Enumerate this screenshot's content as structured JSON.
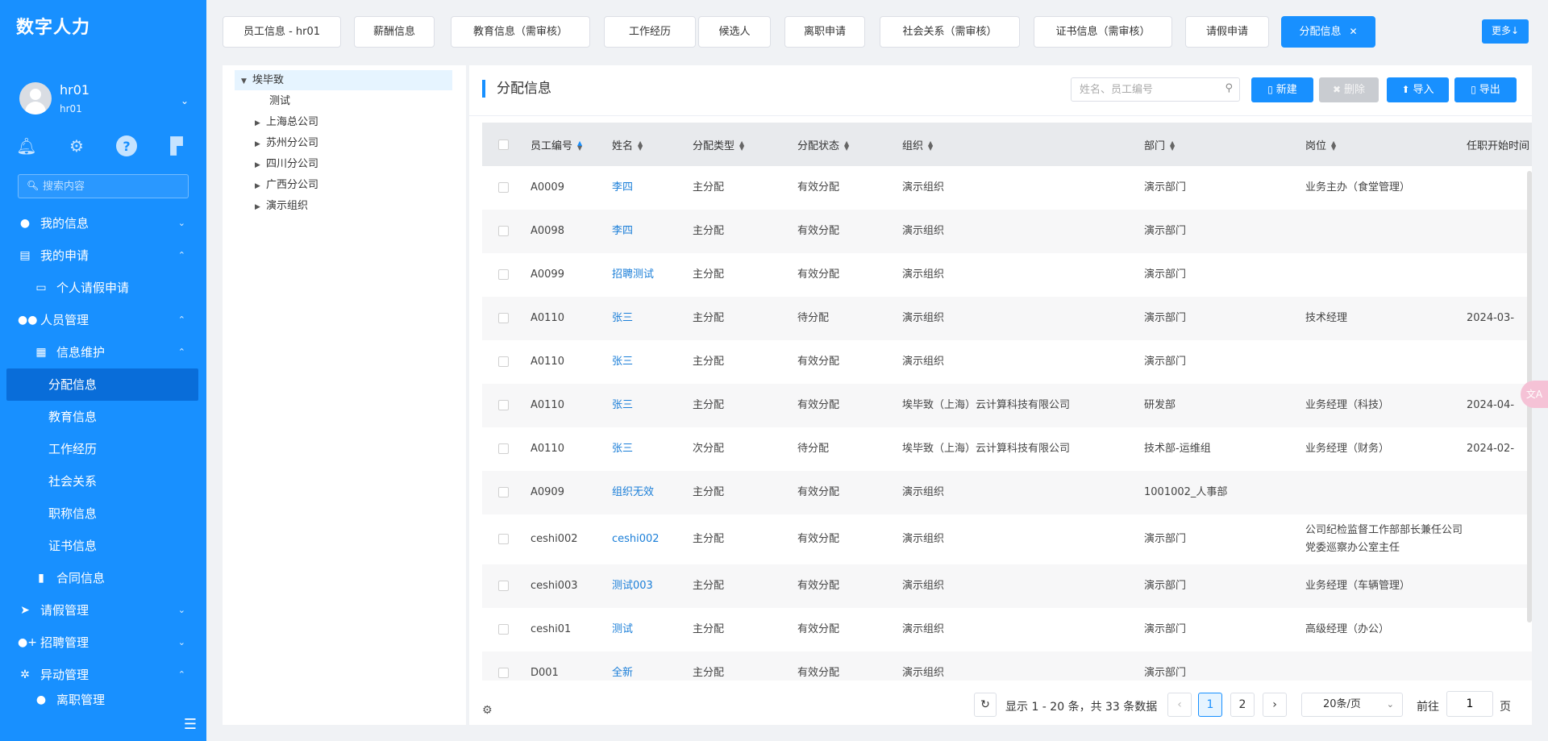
{
  "app": {
    "title": "数字人力"
  },
  "user": {
    "name": "hr01",
    "sub": "hr01"
  },
  "sidebar": {
    "search_placeholder": "搜索内容",
    "items": [
      {
        "label": "我的信息",
        "icon": "user-icon"
      },
      {
        "label": "我的申请",
        "icon": "document-icon"
      },
      {
        "label": "个人请假申请",
        "icon": "id-card-icon"
      },
      {
        "label": "人员管理",
        "icon": "users-icon"
      },
      {
        "label": "信息维护",
        "icon": "calendar-icon"
      },
      {
        "label": "分配信息"
      },
      {
        "label": "教育信息"
      },
      {
        "label": "工作经历"
      },
      {
        "label": "社会关系"
      },
      {
        "label": "职称信息"
      },
      {
        "label": "证书信息"
      },
      {
        "label": "合同信息",
        "icon": "book-icon"
      },
      {
        "label": "请假管理",
        "icon": "send-icon"
      },
      {
        "label": "招聘管理",
        "icon": "user-add-icon"
      },
      {
        "label": "异动管理",
        "icon": "gear-icon"
      },
      {
        "label": "离职管理",
        "icon": "user-icon"
      }
    ]
  },
  "tabs": [
    {
      "label": "员工信息 - hr01"
    },
    {
      "label": "薪酬信息"
    },
    {
      "label": "教育信息（需审核）"
    },
    {
      "label": "工作经历"
    },
    {
      "label": "候选人"
    },
    {
      "label": "离职申请"
    },
    {
      "label": "社会关系（需审核）"
    },
    {
      "label": "证书信息（需审核）"
    },
    {
      "label": "请假申请"
    },
    {
      "label": "分配信息",
      "active": true
    }
  ],
  "more_label": "更多↓",
  "tree": {
    "root": "埃毕致",
    "children": [
      "测试",
      "上海总公司",
      "苏州分公司",
      "四川分公司",
      "广西分公司",
      "演示组织"
    ]
  },
  "main": {
    "title": "分配信息",
    "search_placeholder": "姓名、员工编号",
    "buttons": {
      "new": "新建",
      "delete": "删除",
      "import": "导入",
      "export": "导出"
    }
  },
  "table": {
    "columns": [
      "员工编号",
      "姓名",
      "分配类型",
      "分配状态",
      "组织",
      "部门",
      "岗位",
      "任职开始时间"
    ],
    "rows": [
      [
        "A0009",
        "李四",
        "主分配",
        "有效分配",
        "演示组织",
        "演示部门",
        "业务主办（食堂管理）",
        ""
      ],
      [
        "A0098",
        "李四",
        "主分配",
        "有效分配",
        "演示组织",
        "演示部门",
        "",
        ""
      ],
      [
        "A0099",
        "招聘测试",
        "主分配",
        "有效分配",
        "演示组织",
        "演示部门",
        "",
        ""
      ],
      [
        "A0110",
        "张三",
        "主分配",
        "待分配",
        "演示组织",
        "演示部门",
        "技术经理",
        "2024-03-"
      ],
      [
        "A0110",
        "张三",
        "主分配",
        "有效分配",
        "演示组织",
        "演示部门",
        "",
        ""
      ],
      [
        "A0110",
        "张三",
        "主分配",
        "有效分配",
        "埃毕致（上海）云计算科技有限公司",
        "研发部",
        "业务经理（科技）",
        "2024-04-"
      ],
      [
        "A0110",
        "张三",
        "次分配",
        "待分配",
        "埃毕致（上海）云计算科技有限公司",
        "技术部-运维组",
        "业务经理（财务）",
        "2024-02-"
      ],
      [
        "A0909",
        "组织无效",
        "主分配",
        "有效分配",
        "演示组织",
        "1001002_人事部",
        "",
        ""
      ],
      [
        "ceshi002",
        "ceshi002",
        "主分配",
        "有效分配",
        "演示组织",
        "演示部门",
        "公司纪检监督工作部部长兼任公司党委巡察办公室主任",
        ""
      ],
      [
        "ceshi003",
        "测试003",
        "主分配",
        "有效分配",
        "演示组织",
        "演示部门",
        "业务经理（车辆管理）",
        ""
      ],
      [
        "ceshi01",
        "测试",
        "主分配",
        "有效分配",
        "演示组织",
        "演示部门",
        "高级经理（办公）",
        ""
      ],
      [
        "D001",
        "全新",
        "主分配",
        "有效分配",
        "演示组织",
        "演示部门",
        "",
        ""
      ]
    ]
  },
  "pagination": {
    "info": "显示 1 - 20 条，共 33 条数据",
    "pages": [
      "1",
      "2"
    ],
    "current": "1",
    "page_size": "20条/页",
    "goto_label": "前往",
    "goto_value": "1",
    "goto_unit": "页"
  },
  "colors": {
    "primary": "#1890ff",
    "sidebar": "#1890ff",
    "active_menu": "#096dd9",
    "link": "#1a7ed8"
  }
}
